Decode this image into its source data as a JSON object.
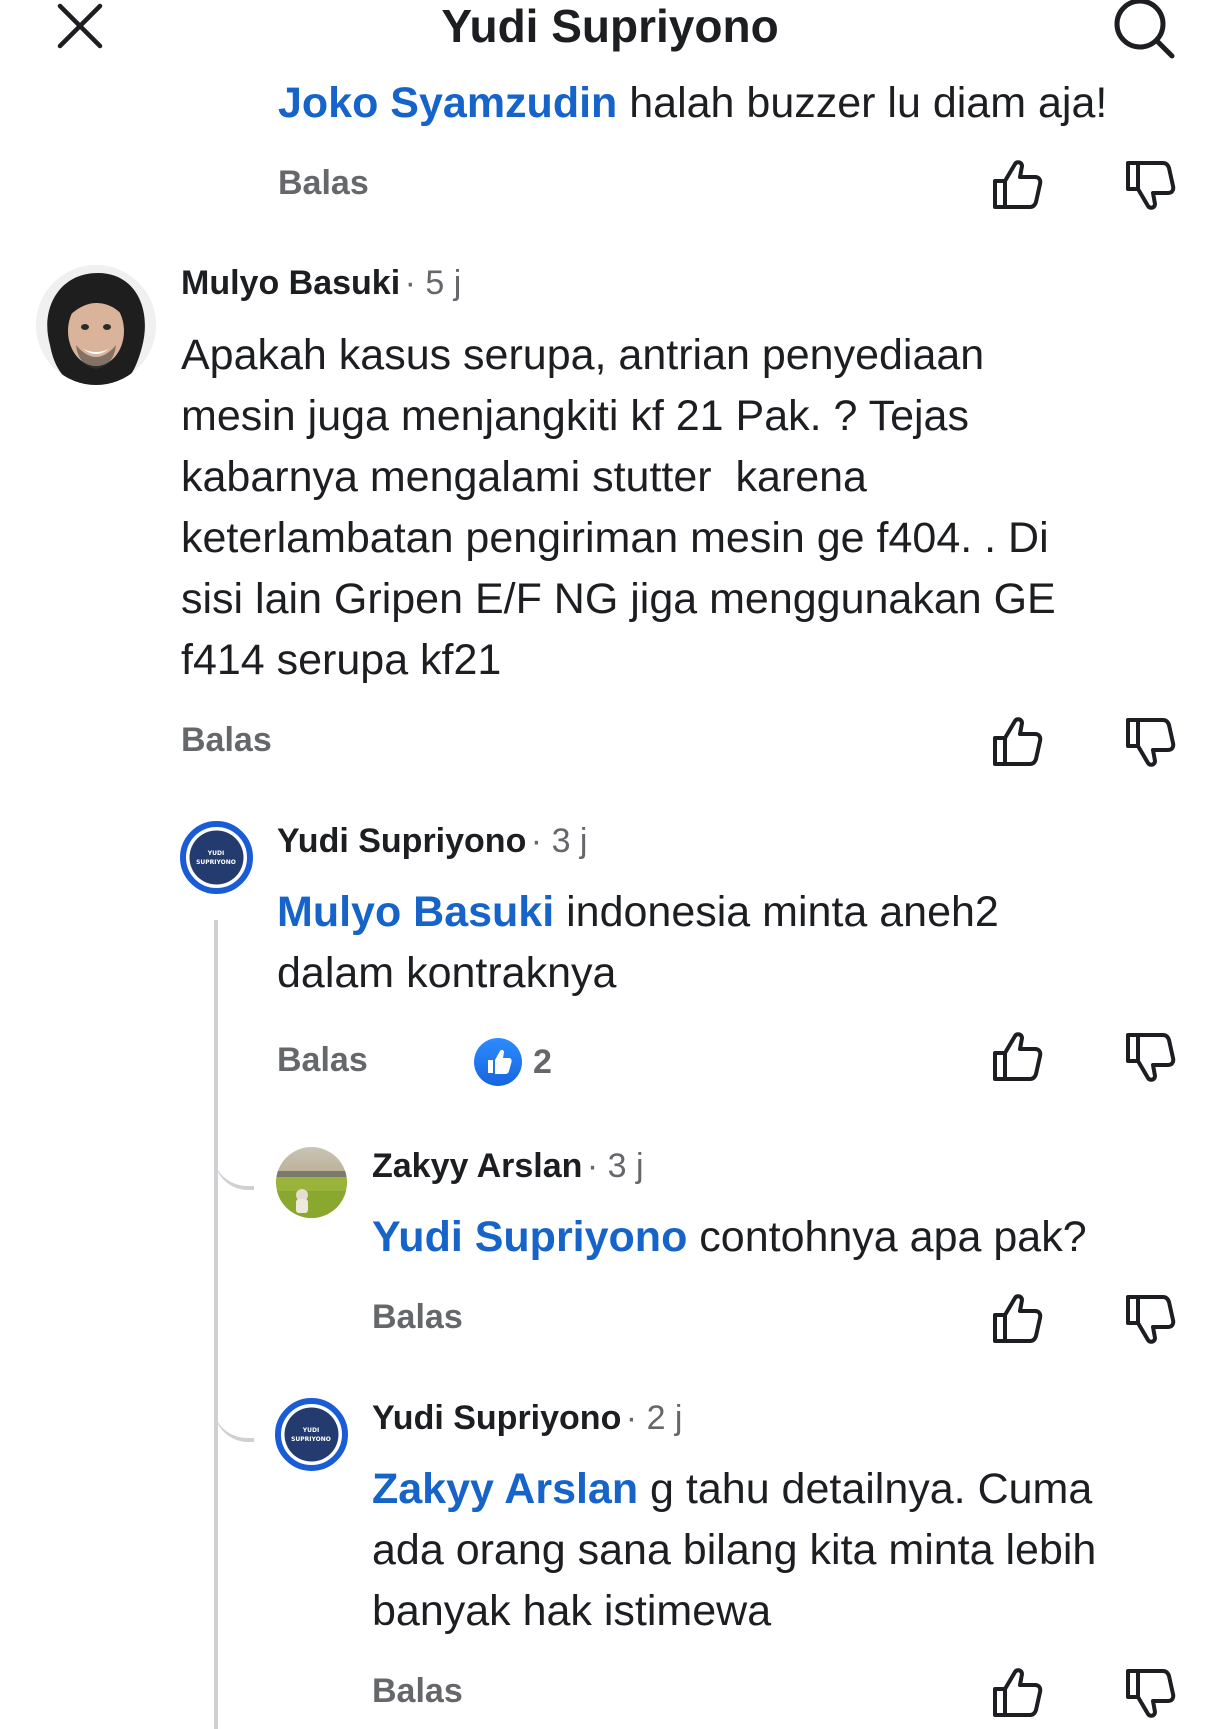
{
  "header": {
    "title": "Yudi Supriyono",
    "close_icon": "close-icon",
    "search_icon": "search-icon"
  },
  "comments": [
    {
      "id": "joko",
      "mention": "Joko Syamzudin",
      "text": " halah buzzer lu diam aja!",
      "reply_label": "Balas"
    },
    {
      "id": "mulyo",
      "author": "Mulyo Basuki",
      "time": "· 5 j",
      "text_lines": [
        "Apakah kasus serupa, antrian penyediaan",
        "mesin juga menjangkiti kf 21 Pak. ? Tejas",
        "kabarnya mengalami stutter  karena",
        "keterlambatan pengiriman mesin ge f404. . Di",
        "sisi lain Gripen E/F NG jiga menggunakan GE",
        "f414 serupa kf21"
      ],
      "reply_label": "Balas"
    },
    {
      "id": "yudi1",
      "author": "Yudi Supriyono",
      "time": "· 3 j",
      "mention": "Mulyo Basuki",
      "text_line1": " indonesia minta aneh2",
      "text_line2": "dalam kontraknya",
      "reply_label": "Balas",
      "reaction_count": "2"
    },
    {
      "id": "zakyy",
      "author": "Zakyy Arslan",
      "time": "· 3 j",
      "mention": "Yudi Supriyono",
      "text": " contohnya apa pak?",
      "reply_label": "Balas"
    },
    {
      "id": "yudi2",
      "author": "Yudi Supriyono",
      "time": "· 2 j",
      "mention": "Zakyy Arslan",
      "text_line1": " g tahu detailnya. Cuma",
      "text_line2": "ada orang sana bilang kita minta lebih",
      "text_line3": "banyak hak istimewa",
      "reply_label": "Balas"
    }
  ],
  "page_logo_text": [
    "YUDI",
    "SUPRIYONO"
  ],
  "colors": {
    "mention": "#1664c9",
    "logo_ring": "#1a5bd6",
    "logo_fill": "#233b6e",
    "secondary_text": "#65676b"
  }
}
